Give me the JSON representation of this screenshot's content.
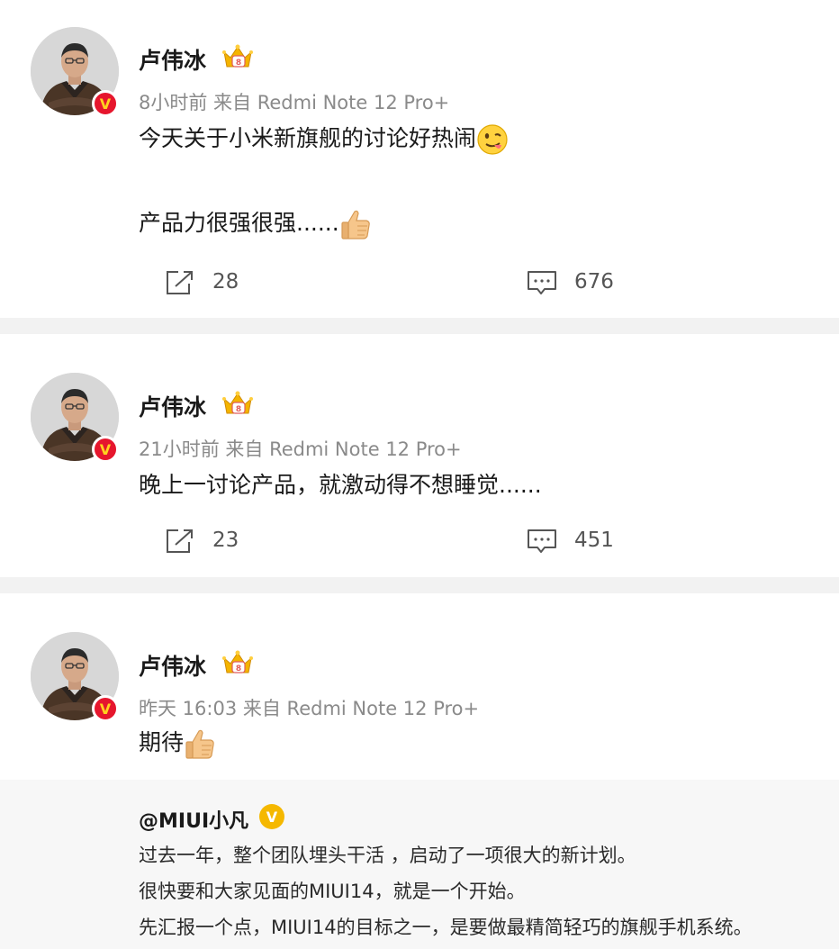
{
  "posts": [
    {
      "author": "卢伟冰",
      "meta": "8小时前  来自 Redmi Note 12 Pro+",
      "lines": [
        "今天关于小米新旗舰的讨论好热闹",
        "",
        "产品力很强很强......"
      ],
      "reposts": "28",
      "comments": "676"
    },
    {
      "author": "卢伟冰",
      "meta": "21小时前  来自 Redmi Note 12 Pro+",
      "lines": [
        "晚上一讨论产品，就激动得不想睡觉......"
      ],
      "reposts": "23",
      "comments": "451"
    },
    {
      "author": "卢伟冰",
      "meta": "昨天 16:03  来自 Redmi Note 12 Pro+",
      "lines": [
        "期待"
      ]
    }
  ],
  "repost": {
    "user": "@MIUI小凡",
    "lines": [
      "过去一年，整个团队埋头干活 ，启动了一项很大的新计划。",
      "很快要和大家见面的MIUI14，就是一个开始。",
      "先汇报一个点，MIUI14的目标之一，是要做最精简轻巧的旗舰手机系统。"
    ]
  },
  "icons": {
    "share": "share-icon",
    "comment": "comment-icon",
    "verified": "v-badge",
    "emoji_tongue": "tongue-emoji",
    "emoji_thumb": "thumbs-up-emoji"
  },
  "colors": {
    "verified_red": "#e6162d",
    "verified_gold": "#f5b800",
    "separator": "#f2f2f2",
    "repost_bg": "#f7f7f7"
  }
}
